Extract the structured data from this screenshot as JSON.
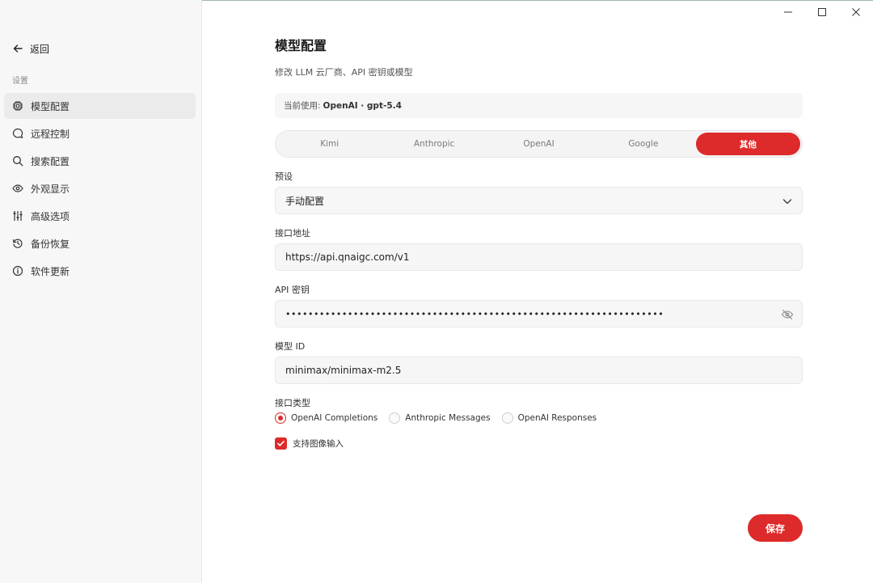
{
  "sidebar": {
    "back_label": "返回",
    "section_label": "设置",
    "items": [
      {
        "label": "模型配置",
        "icon": "chip-icon",
        "active": true
      },
      {
        "label": "远程控制",
        "icon": "chat-bubble-icon",
        "active": false
      },
      {
        "label": "搜索配置",
        "icon": "search-icon",
        "active": false
      },
      {
        "label": "外观显示",
        "icon": "eye-icon",
        "active": false
      },
      {
        "label": "高级选项",
        "icon": "sliders-icon",
        "active": false
      },
      {
        "label": "备份恢复",
        "icon": "history-icon",
        "active": false
      },
      {
        "label": "软件更新",
        "icon": "info-icon",
        "active": false
      }
    ]
  },
  "window_controls": [
    "minimize-icon",
    "maximize-icon",
    "close-icon"
  ],
  "main": {
    "title": "模型配置",
    "subtitle": "修改 LLM 云厂商、API 密钥或模型",
    "current_prefix": "当前使用:",
    "current_value": "OpenAI · gpt-5.4",
    "tabs": [
      {
        "label": "Kimi",
        "active": false
      },
      {
        "label": "Anthropic",
        "active": false
      },
      {
        "label": "OpenAI",
        "active": false
      },
      {
        "label": "Google",
        "active": false
      },
      {
        "label": "其他",
        "active": true
      }
    ],
    "preset": {
      "label": "预设",
      "value": "手动配置"
    },
    "endpoint": {
      "label": "接口地址",
      "value": "https://api.qnaigc.com/v1"
    },
    "api_key": {
      "label": "API 密钥",
      "value": "•••••••••••••••••••••••••••••••••••••••••••••••••••••••••••••••••••"
    },
    "model_id": {
      "label": "模型 ID",
      "value": "minimax/minimax-m2.5"
    },
    "api_type": {
      "label": "接口类型",
      "options": [
        {
          "label": "OpenAI Completions",
          "selected": true
        },
        {
          "label": "Anthropic Messages",
          "selected": false
        },
        {
          "label": "OpenAI Responses",
          "selected": false
        }
      ]
    },
    "image_input": {
      "label": "支持图像输入",
      "checked": true
    },
    "save_label": "保存"
  },
  "colors": {
    "accent": "#dd2a2a",
    "sidebar_bg": "#f7f7f7",
    "field_bg": "#f6f6f6"
  }
}
